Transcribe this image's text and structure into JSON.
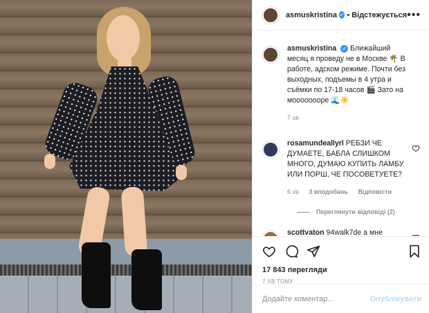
{
  "post": {
    "username": "asmuskristina",
    "follow_label": "Відстежується",
    "more_label": "•••",
    "caption": "Ближайший месяц я проведу не в Москве 🌴 В работе, адском режиме. Почти без выходных, подъемы в 4 утра и съёмки по 17-18 часов 🎬 Зато на моооооооре 🌊☀️",
    "caption_time": "7 хв"
  },
  "comments": [
    {
      "username": "rosamundeallyrl",
      "text": "РЕБЗИ ЧЕ ДУМАЕТЕ, БАБЛА СЛИШКОМ МНОГО, ДУМАЮ КУПИТЬ ЛАМБУ ИЛИ ПОРШ, ЧЕ ПОСОВЕТУЕТЕ?",
      "time": "6 хв",
      "likes": "3 вподобань",
      "reply": "Відповісти",
      "view_replies": "Переглянути відповіді (2)"
    },
    {
      "username": "scottvaton",
      "text": "94walk7de а мне"
    }
  ],
  "stats": {
    "views": "17 843 перегляди",
    "ago": "7 ХВ ТОМУ"
  },
  "comment_box": {
    "placeholder": "Додайте коментар...",
    "publish": "Опублікувати"
  }
}
